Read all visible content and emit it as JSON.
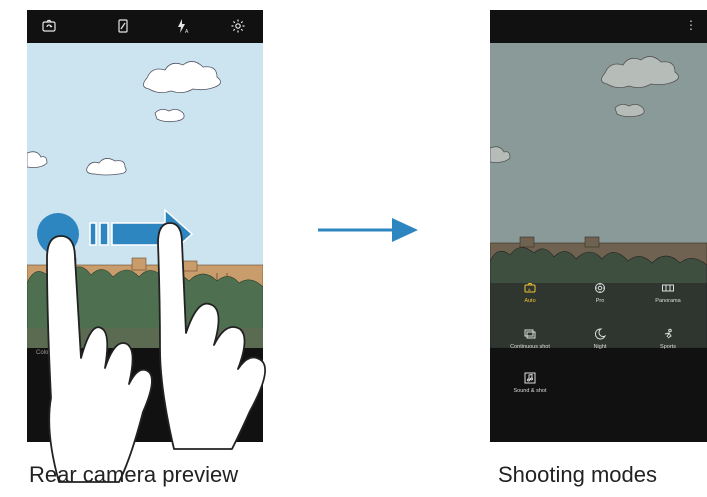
{
  "left_screen": {
    "top_icons": [
      "switch-camera-icon",
      "hdr-icon",
      "flash-auto-icon",
      "settings-icon"
    ],
    "mode_label": "Color"
  },
  "right_screen": {
    "more_icon": "more-options-icon",
    "modes": [
      {
        "label": "Auto",
        "icon": "auto-mode-icon",
        "selected": true
      },
      {
        "label": "Pro",
        "icon": "pro-mode-icon",
        "selected": false
      },
      {
        "label": "Panorama",
        "icon": "panorama-icon",
        "selected": false
      },
      {
        "label": "Continuous shot",
        "icon": "continuous-shot-icon",
        "selected": false
      },
      {
        "label": "Night",
        "icon": "night-icon",
        "selected": false
      },
      {
        "label": "Sports",
        "icon": "sports-icon",
        "selected": false
      },
      {
        "label": "Sound & shot",
        "icon": "sound-shot-icon",
        "selected": false
      }
    ]
  },
  "captions": {
    "left": "Rear camera preview",
    "right": "Shooting modes"
  },
  "colors": {
    "sky": "#cbe4f0",
    "arrow": "#2e86c1",
    "selected_mode": "#f2c233"
  }
}
